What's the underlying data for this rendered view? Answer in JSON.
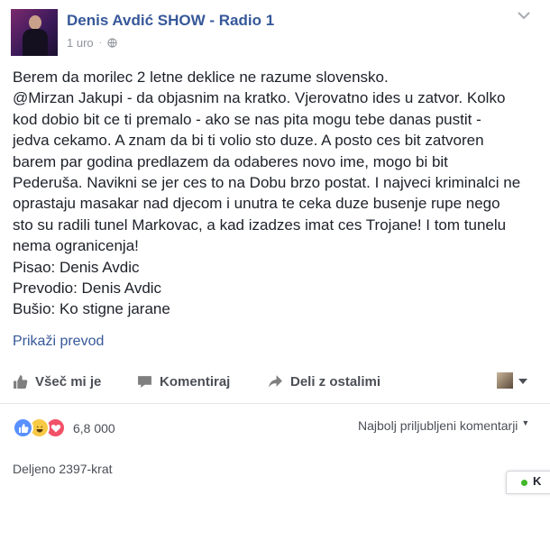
{
  "post": {
    "author": "Denis Avdić SHOW - Radio 1",
    "timestamp": "1 uro",
    "privacy_icon": "globe-icon",
    "menu_icon": "chevron-down-icon",
    "body_lines": [
      "Berem da morilec 2 letne deklice ne razume slovensko.",
      "@Mirzan Jakupi - da objasnim na kratko. Vjerovatno ides u zatvor. Kolko",
      "kod dobio bit ce ti premalo - ako se nas pita mogu tebe danas pustit -",
      "jedva cekamo. A znam da bi ti volio sto duze. A posto ces bit zatvoren",
      "barem par godina predlazem da odaberes novo ime, mogo bi bit",
      "Pederuša. Navikni se jer ces to na Dobu brzo postat. I najveci kriminalci ne",
      "oprastaju masakar nad djecom i unutra te ceka duze busenje rupe nego",
      "sto su radili tunel Markovac, a kad izadzes imat ces Trojane! I tom tunelu",
      "nema ogranicenja!",
      "Pisao: Denis Avdic",
      "Prevodio: Denis Avdic",
      "Bušio: Ko stigne jarane"
    ],
    "translate_link": "Prikaži prevod"
  },
  "actions": {
    "like": "Všeč mi je",
    "comment": "Komentiraj",
    "share": "Deli z ostalimi"
  },
  "reactions": {
    "icons": [
      "like-icon",
      "haha-icon",
      "love-icon"
    ],
    "count": "6,8 000"
  },
  "comments_sort": "Najbolj priljubljeni komentarji",
  "share_count": "Deljeno 2397-krat",
  "chat": {
    "label": "K"
  },
  "colors": {
    "link": "#365899",
    "text": "#1d2129",
    "secondary": "#90949c",
    "like_blue": "#5890ff",
    "love_red": "#f25268",
    "haha_yellow": "#f7c945",
    "online_green": "#42b72a"
  }
}
